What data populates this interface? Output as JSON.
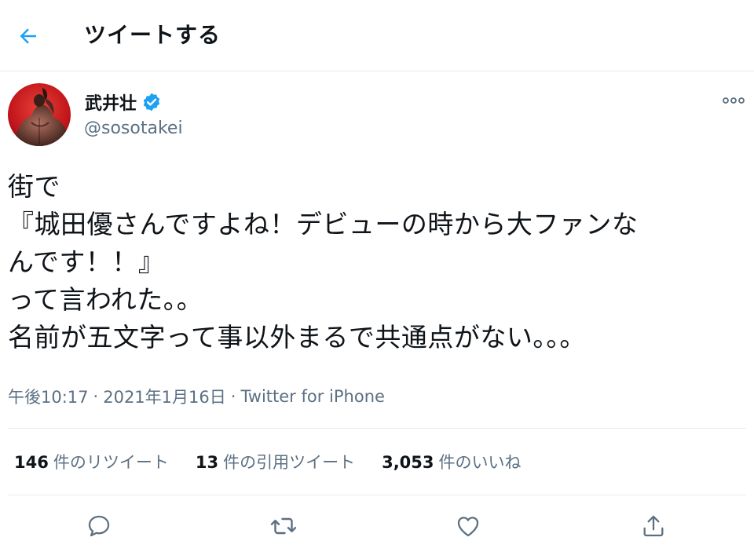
{
  "header": {
    "back_icon": "arrow-left-icon",
    "title": "ツイートする"
  },
  "author": {
    "avatar_icon": "avatar",
    "display_name": "武井壮",
    "verified_icon": "verified-badge-icon",
    "handle": "@sosotakei"
  },
  "more_icon": "more-icon",
  "tweet": {
    "lines": [
      "街で",
      "『城田優さんですよね！デビューの時から大ファンな",
      "んです！！』",
      "って言われた。。",
      "名前が五文字って事以外まるで共通点がない。。。"
    ]
  },
  "meta": {
    "time": "午後10:17",
    "separator1": "·",
    "date": "2021年1月16日",
    "separator2": "·",
    "source": "Twitter for iPhone"
  },
  "stats": {
    "retweets_count": "146",
    "retweets_label": "件のリツイート",
    "quotes_count": "13",
    "quotes_label": "件の引用ツイート",
    "likes_count": "3,053",
    "likes_label": "件のいいね"
  },
  "actions": {
    "reply_icon": "reply-icon",
    "retweet_icon": "retweet-icon",
    "like_icon": "heart-icon",
    "share_icon": "share-icon"
  },
  "colors": {
    "accent": "#1da1f2",
    "text": "#0f1419",
    "secondary": "#5b7083",
    "border": "#e6ecf0"
  }
}
